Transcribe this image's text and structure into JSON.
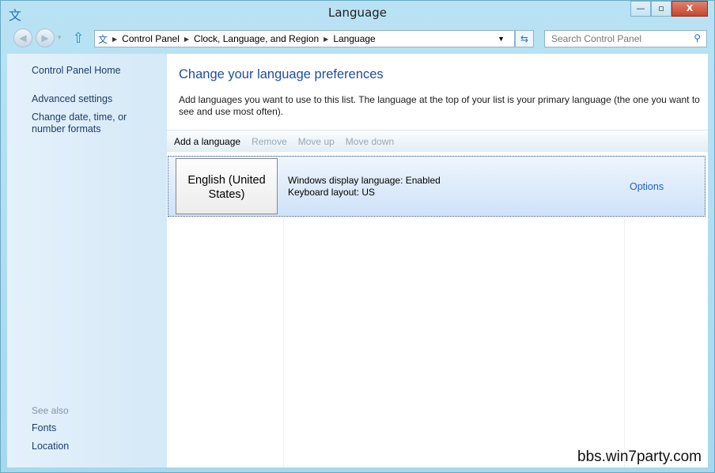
{
  "window": {
    "title": "Language",
    "minimize": "—",
    "maximize": "▫",
    "close": "X"
  },
  "nav": {
    "back": "◀",
    "forward": "▶",
    "history": "▾",
    "up": "⇧"
  },
  "address": {
    "crumbs": [
      "Control Panel",
      "Clock, Language, and Region",
      "Language"
    ]
  },
  "search": {
    "placeholder": "Search Control Panel"
  },
  "sidebar": {
    "items": [
      {
        "label": "Control Panel Home"
      },
      {
        "label": "Advanced settings"
      },
      {
        "label": "Change date, time, or number formats"
      }
    ],
    "see_also": "See also",
    "see_also_items": [
      {
        "label": "Fonts"
      },
      {
        "label": "Location"
      }
    ]
  },
  "main": {
    "title": "Change your language preferences",
    "description": "Add languages you want to use to this list. The language at the top of your list is your primary language (the one you want to see and use most often).",
    "toolbar": {
      "add": "Add a language",
      "remove": "Remove",
      "move_up": "Move up",
      "move_down": "Move down"
    },
    "languages": [
      {
        "name": "English (United States)",
        "display": "Windows display language: Enabled",
        "keyboard": "Keyboard layout: US",
        "options": "Options"
      }
    ]
  },
  "watermark": "bbs.win7party.com"
}
